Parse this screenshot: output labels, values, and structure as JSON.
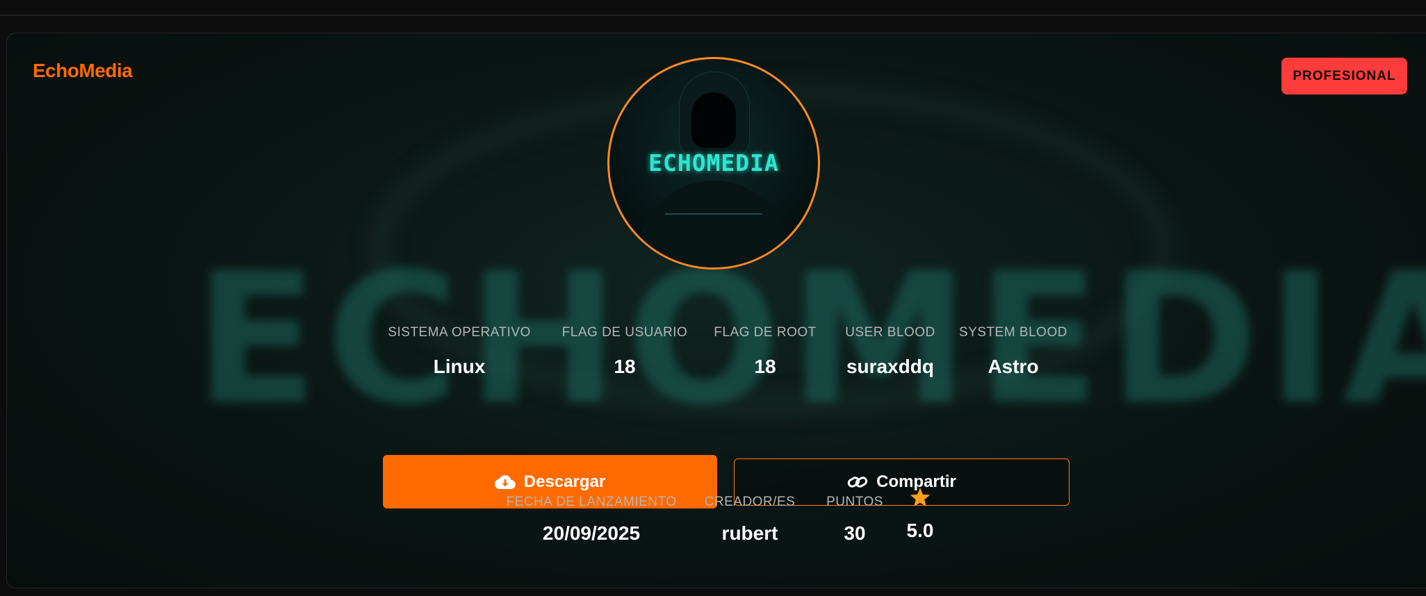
{
  "brand": "EchoMedia",
  "badge": "PROFESIONAL",
  "avatar_text": "ECHOMEDIA",
  "background_text": "ECHOMEDIA",
  "stats": [
    {
      "label": "SISTEMA OPERATIVO",
      "value": "Linux"
    },
    {
      "label": "FLAG DE USUARIO",
      "value": "18"
    },
    {
      "label": "FLAG DE ROOT",
      "value": "18"
    },
    {
      "label": "USER BLOOD",
      "value": "suraxddq"
    },
    {
      "label": "SYSTEM BLOOD",
      "value": "Astro"
    }
  ],
  "buttons": {
    "download": "Descargar",
    "share": "Compartir"
  },
  "meta": {
    "release_label": "FECHA DE LANZAMIENTO",
    "release_value": "20/09/2025",
    "creator_label": "CREADOR/ES",
    "creator_value": "rubert",
    "points_label": "PUNTOS",
    "points_value": "30",
    "rating_value": "5.0"
  },
  "icons": {
    "download": "cloud-download-icon",
    "share": "link-icon",
    "rating": "star-icon"
  },
  "colors": {
    "accent": "#ff6a00",
    "badge": "#ff3b3b",
    "star": "#ff9f1a",
    "avatar_border": "#ff8a1e",
    "avatar_text": "#2ee6d0"
  }
}
